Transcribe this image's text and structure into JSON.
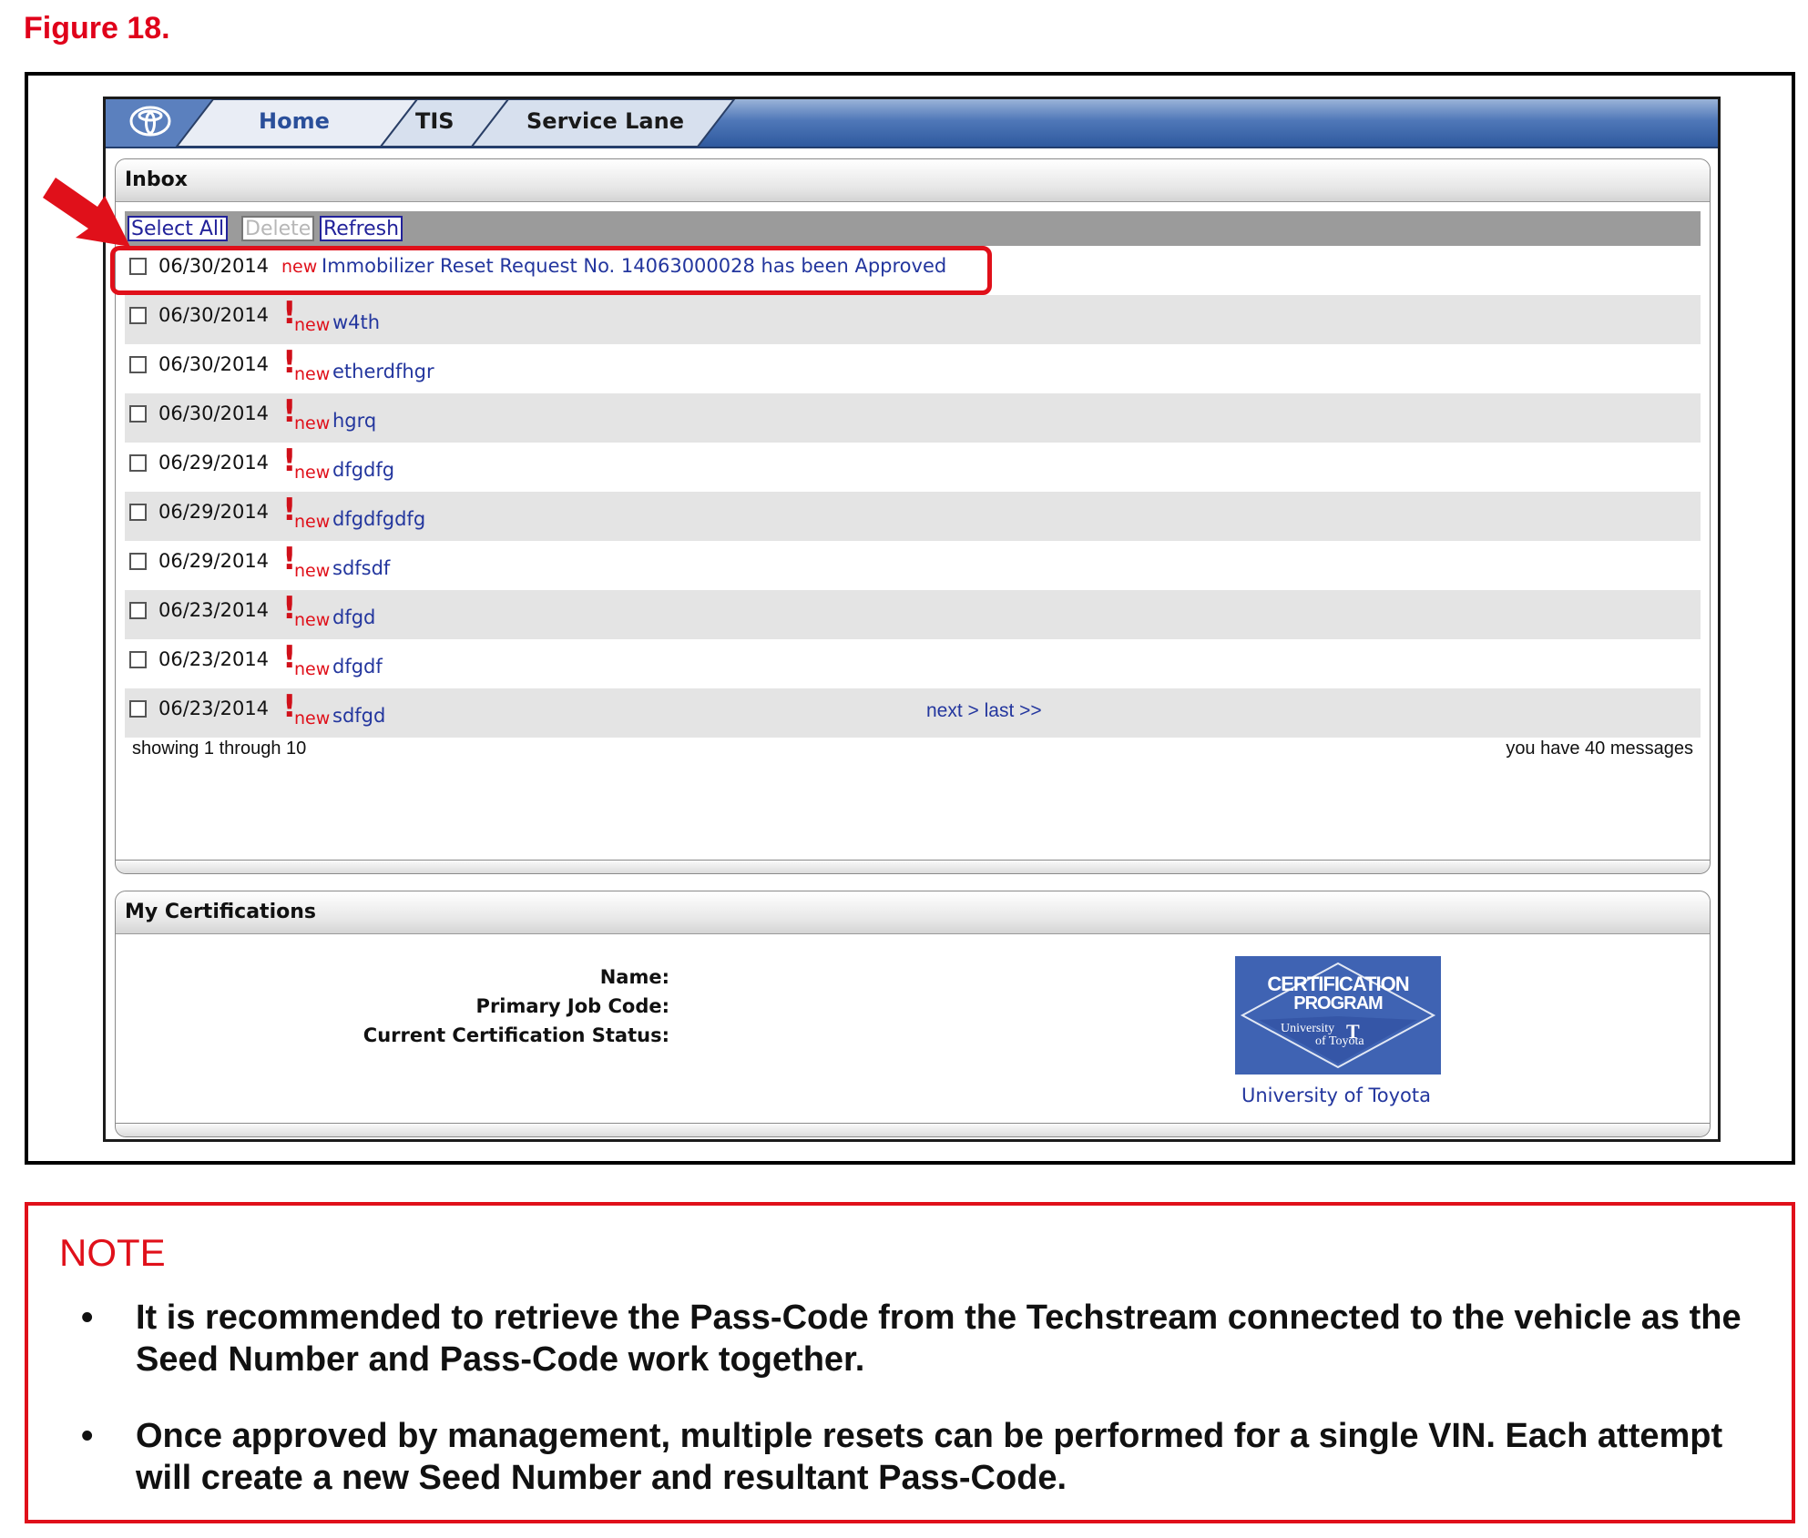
{
  "figure_label": "Figure 18.",
  "nav": {
    "tabs": [
      {
        "label": "Home",
        "active": true
      },
      {
        "label": "TIS",
        "active": false
      },
      {
        "label": "Service Lane",
        "active": false
      }
    ]
  },
  "inbox": {
    "title": "Inbox",
    "toolbar": {
      "select_all": "Select All",
      "delete": "Delete",
      "refresh": "Refresh"
    },
    "new_label": "new",
    "messages": [
      {
        "date": "06/30/2014",
        "urgent": false,
        "subject": "Immobilizer Reset Request No. 14063000028 has been Approved"
      },
      {
        "date": "06/30/2014",
        "urgent": true,
        "subject": "w4th"
      },
      {
        "date": "06/30/2014",
        "urgent": true,
        "subject": "etherdfhgr"
      },
      {
        "date": "06/30/2014",
        "urgent": true,
        "subject": "hgrq"
      },
      {
        "date": "06/29/2014",
        "urgent": true,
        "subject": "dfgdfg"
      },
      {
        "date": "06/29/2014",
        "urgent": true,
        "subject": "dfgdfgdfg"
      },
      {
        "date": "06/29/2014",
        "urgent": true,
        "subject": "sdfsdf"
      },
      {
        "date": "06/23/2014",
        "urgent": true,
        "subject": "dfgd"
      },
      {
        "date": "06/23/2014",
        "urgent": true,
        "subject": "dfgdf"
      },
      {
        "date": "06/23/2014",
        "urgent": true,
        "subject": "sdfgd"
      }
    ],
    "pager": "next > last >>",
    "showing": "showing 1 through 10",
    "message_count": "you have 40 messages"
  },
  "certifications": {
    "title": "My Certifications",
    "name_label": "Name:",
    "job_code_label": "Primary Job Code:",
    "status_label": "Current Certification Status:",
    "logo_line1": "CERTIFICATION",
    "logo_line2": "PROGRAM",
    "logo_university": "University",
    "logo_of_toyota": "of Toyota",
    "link": "University of Toyota"
  },
  "note": {
    "title": "NOTE",
    "items": [
      "It is recommended to retrieve the Pass-Code from the Techstream connected to the vehicle as the Seed Number and Pass-Code work together.",
      "Once approved by management, multiple resets can be performed for a single VIN. Each attempt will create a new Seed Number and resultant Pass-Code."
    ]
  },
  "colors": {
    "accent_red": "#e0101a",
    "link_blue": "#23369e",
    "nav_blue": "#4f77b8",
    "logo_blue": "#3f63b3"
  }
}
